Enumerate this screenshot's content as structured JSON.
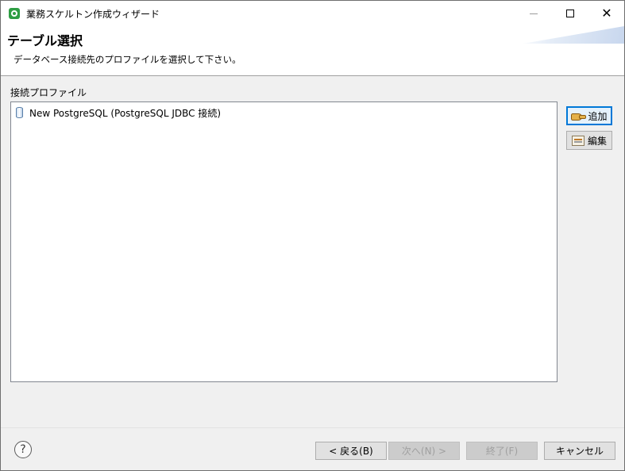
{
  "window": {
    "title": "業務スケルトン作成ウィザード",
    "minimize_glyph": "",
    "close_glyph": "✕"
  },
  "banner": {
    "title": "テーブル選択",
    "description": "データベース接続先のプロファイルを選択して下さい。"
  },
  "profiles": {
    "label": "接続プロファイル",
    "items": [
      {
        "label": "New PostgreSQL (PostgreSQL JDBC 接続)",
        "icon": "database-icon"
      }
    ]
  },
  "side_buttons": {
    "add_label": "追加",
    "edit_label": "編集"
  },
  "footer": {
    "help_glyph": "?",
    "back_label": "< 戻る(B)",
    "next_label": "次へ(N) >",
    "finish_label": "終了(F)",
    "cancel_label": "キャンセル"
  },
  "colors": {
    "accent": "#0078d7",
    "app_icon": "#2f9e44"
  }
}
